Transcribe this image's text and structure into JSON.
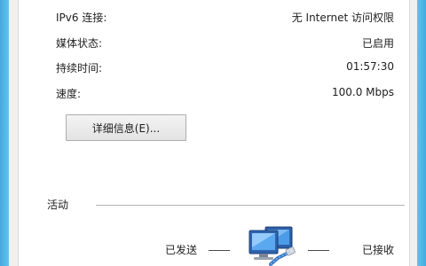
{
  "connection": {
    "rows": [
      {
        "label": "IPv6 连接:",
        "value": "无 Internet 访问权限"
      },
      {
        "label": "媒体状态:",
        "value": "已启用"
      },
      {
        "label": "持续时间:",
        "value": "01:57:30"
      },
      {
        "label": "速度:",
        "value": "100.0 Mbps"
      }
    ],
    "details_button_label": "详细信息(E)..."
  },
  "activity": {
    "title": "活动",
    "sent_label": "已发送",
    "received_label": "已接收",
    "icon": "network-computers-icon"
  }
}
